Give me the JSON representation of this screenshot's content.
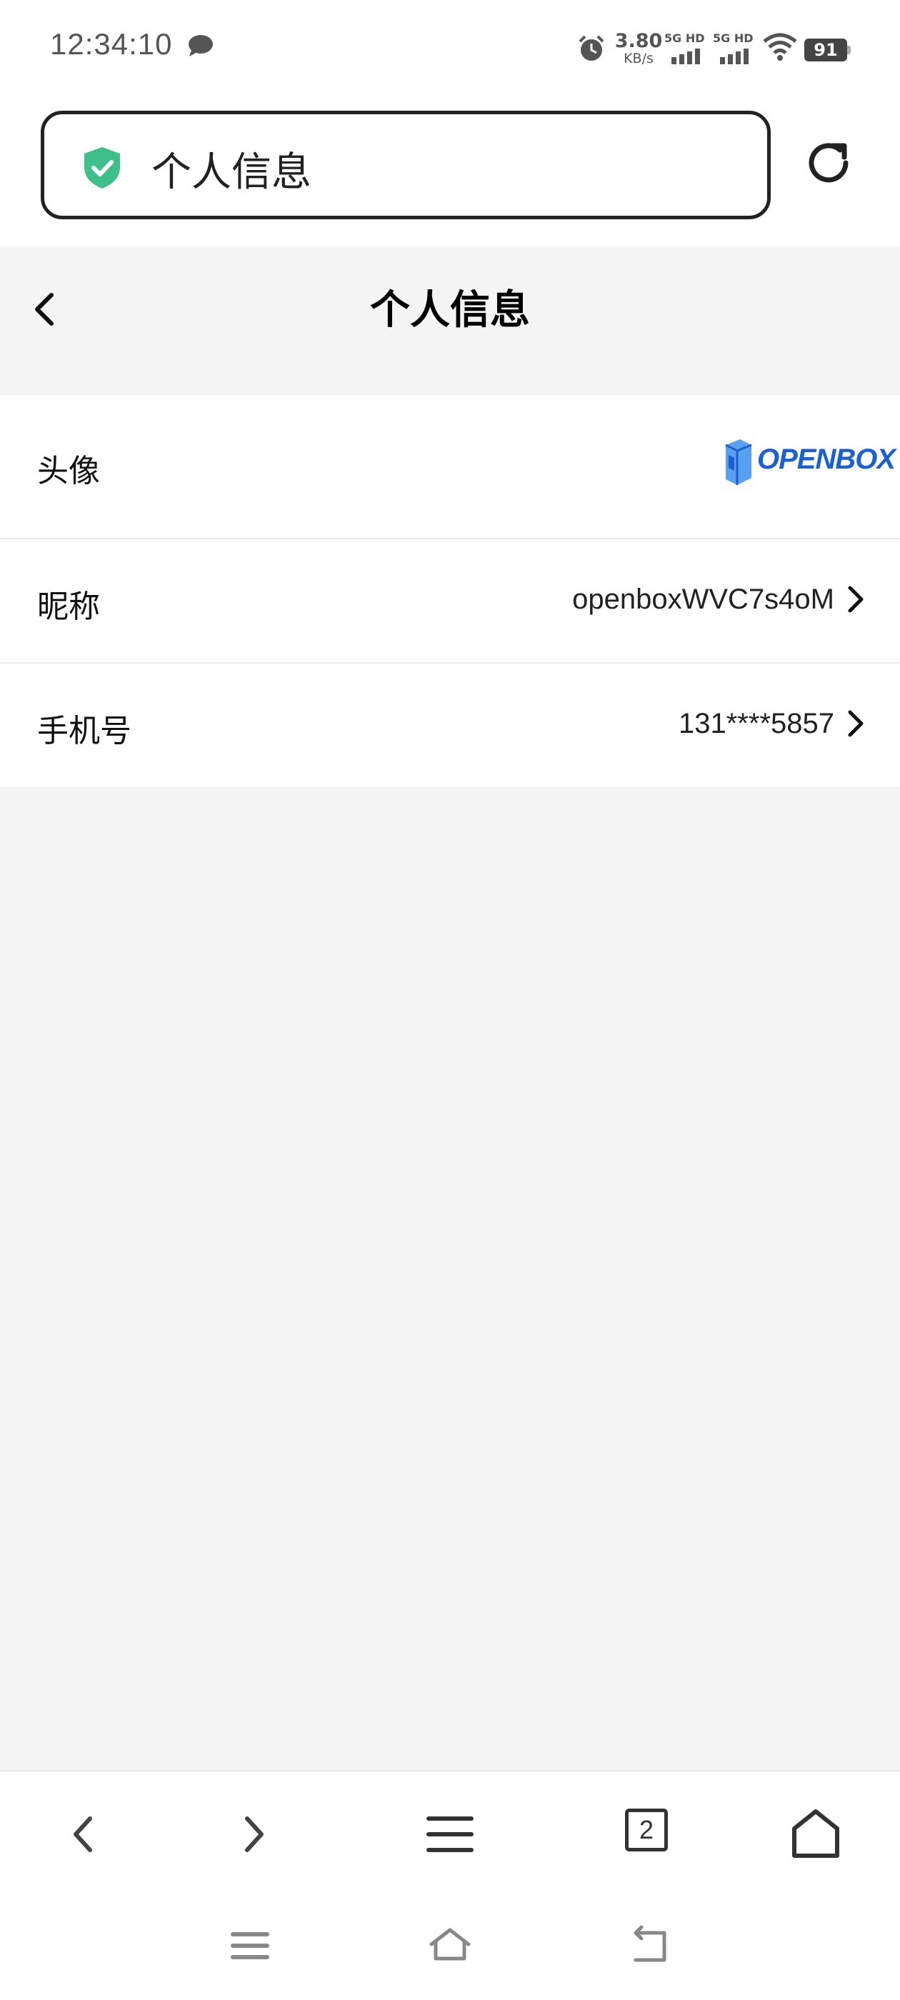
{
  "status_bar": {
    "time": "12:34:10",
    "net_speed_value": "3.80",
    "net_speed_unit": "KB/s",
    "sim1_label": "5G HD",
    "sim2_label": "5G HD",
    "battery": "91"
  },
  "url_bar": {
    "title": "个人信息"
  },
  "header": {
    "title": "个人信息"
  },
  "rows": [
    {
      "label": "头像",
      "value": "OPENBOX"
    },
    {
      "label": "昵称",
      "value": "openboxWVC7s4oM"
    },
    {
      "label": "手机号",
      "value": "131****5857"
    }
  ],
  "toolbar": {
    "tab_count": "2"
  },
  "colors": {
    "shield": "#3fbf8a",
    "logo": "#1b5fd0",
    "background": "#f4f4f4"
  }
}
